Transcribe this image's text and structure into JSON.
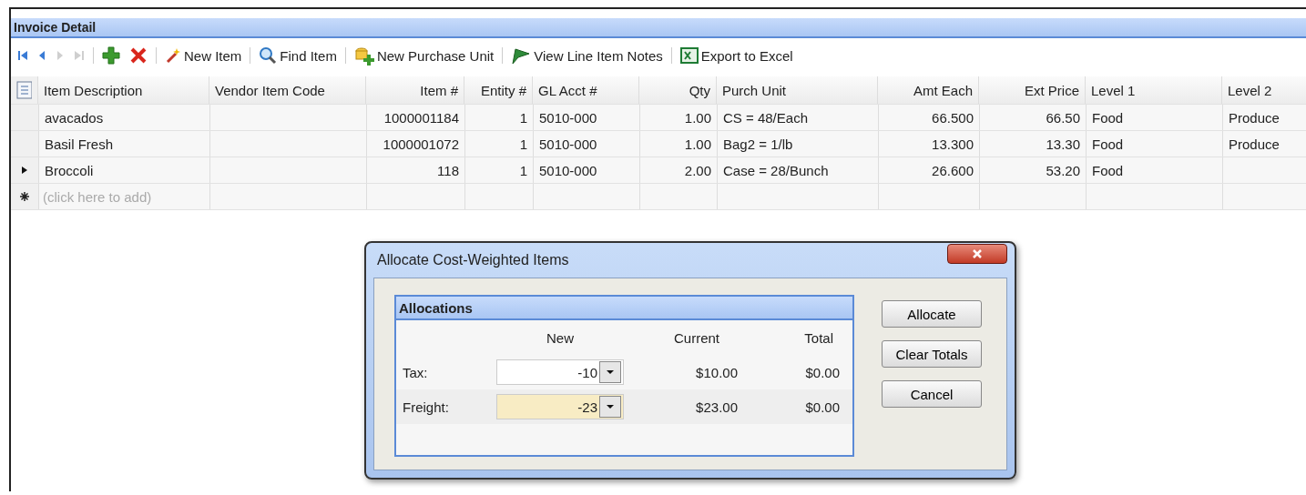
{
  "panel": {
    "title": "Invoice Detail"
  },
  "toolbar": [
    {
      "kind": "first",
      "disabled": false
    },
    {
      "kind": "prev",
      "disabled": false
    },
    {
      "kind": "next",
      "disabled": true
    },
    {
      "kind": "last",
      "disabled": true
    },
    {
      "kind": "add",
      "disabled": false
    },
    {
      "kind": "delete",
      "disabled": false
    },
    {
      "kind": "wand",
      "label": "New Item",
      "disabled": false
    },
    {
      "kind": "search",
      "label": "Find Item",
      "disabled": false
    },
    {
      "kind": "unit",
      "label": "New Purchase Unit",
      "disabled": false
    },
    {
      "kind": "notes",
      "label": "View Line Item Notes",
      "disabled": false
    },
    {
      "kind": "excel",
      "label": "Export to Excel",
      "disabled": false
    }
  ],
  "table": {
    "columns": [
      "Item Description",
      "Vendor Item Code",
      "Item #",
      "Entity #",
      "GL Acct #",
      "Qty",
      "Purch Unit",
      "Amt Each",
      "Ext Price",
      "Level 1",
      "Level 2"
    ],
    "rows": [
      {
        "current": false,
        "cells": [
          "avacados",
          "",
          "1000001184",
          "1",
          "5010-000",
          "1.00",
          "CS = 48/Each",
          "66.500",
          "66.50",
          "Food",
          "Produce"
        ]
      },
      {
        "current": false,
        "cells": [
          "Basil Fresh",
          "",
          "1000001072",
          "1",
          "5010-000",
          "1.00",
          "Bag2 = 1/lb",
          "13.300",
          "13.30",
          "Food",
          "Produce"
        ]
      },
      {
        "current": true,
        "cells": [
          "Broccoli",
          "",
          "118",
          "1",
          "5010-000",
          "2.00",
          "Case = 28/Bunch",
          "26.600",
          "53.20",
          "Food",
          ""
        ]
      }
    ],
    "new_row_placeholder": "(click here to add)"
  },
  "dialog": {
    "title": "Allocate Cost-Weighted Items",
    "group": {
      "title": "Allocations",
      "columns": [
        "New",
        "Current",
        "Total"
      ],
      "rows": [
        {
          "label": "Tax:",
          "new": "-10",
          "focused": false,
          "current": "$10.00",
          "total": "$0.00"
        },
        {
          "label": "Freight:",
          "new": "-23",
          "focused": true,
          "current": "$23.00",
          "total": "$0.00"
        }
      ]
    },
    "buttons": [
      "Allocate",
      "Clear Totals",
      "Cancel"
    ]
  }
}
